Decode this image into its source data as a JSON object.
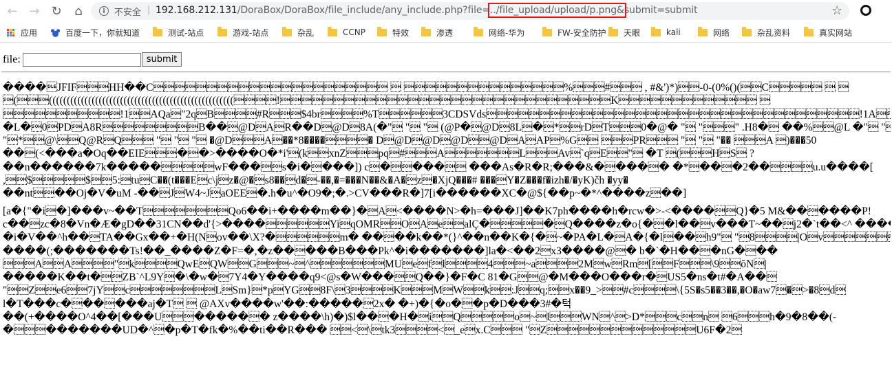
{
  "browser": {
    "security_label": "不安全",
    "url_host": "192.168.212.131",
    "url_path_before": "/DoraBox/DoraBox/file_include/any_include.php?file=",
    "url_highlight": "../file_upload/upload/p.png&",
    "url_path_after": "submit=submit",
    "highlight_color": "#e0161b"
  },
  "bookmarks": [
    {
      "label": "应用",
      "icon": "apps-icon"
    },
    {
      "label": "百度一下，你就知道",
      "icon": "paw-icon"
    },
    {
      "label": "测试-站点",
      "icon": "folder-icon"
    },
    {
      "label": "游戏-站点",
      "icon": "folder-icon"
    },
    {
      "label": "杂乱",
      "icon": "folder-icon"
    },
    {
      "label": "CCNP",
      "icon": "folder-icon"
    },
    {
      "label": "特效",
      "icon": "folder-icon"
    },
    {
      "label": "渗透",
      "icon": "folder-icon"
    },
    {
      "label": "网络-华为",
      "icon": "folder-icon"
    },
    {
      "label": "FW-安全防护",
      "icon": "folder-icon"
    },
    {
      "label": "天眼",
      "icon": "folder-icon"
    },
    {
      "label": "kali",
      "icon": "folder-icon"
    },
    {
      "label": "网络",
      "icon": "folder-icon"
    },
    {
      "label": "杂乱资料",
      "icon": "folder-icon"
    },
    {
      "label": "真实网站",
      "icon": "folder-icon"
    }
  ],
  "form": {
    "label": "file:",
    "input_value": "",
    "submit_label": "submit"
  },
  "output_lines": [
    "����\u0010JFIF\u0001\u0001\u0001HH��C\u0001\u0001\u0001\u0001\u0001\u0001\u0001\u0001\u0001\u0001\u0001\u0001\u0001\u0001\u0001\u0001\u0001\u0001\u0001\u0001\u0001\u0001 \u0001 \u0001\u0001\u0001\u0001\u0001\u0001\u0001\u0001\u0001\u0001\u0001\u0001\u0001\u0001\u0001%\u0001\u0001\u0001#\u0001\u0001\u0001 , #&')*)\u0001\u0001-0-(0%()(\u0001\u0001C\u0001\u0001\u0001\u0001\u0001 \u0001 \u0001",
    "\u0001(\u0001\u0001\u0001((((((((((((((((((((((((((((((((((((((((((((((((((((\u0001\u0001\u0001\u0001!\u0001\u0001\u0001\u0001\u0001\u0001\u0001\u0001\u0001\u0001\u0001\u0001\u0001\u0001\u0001\u0001\u0001\u0001\u0001\u0001\u0001\u0001\u0001\u0001\u0001\u0001\u0001\u0001\u0001\u0001\u0001K\u0001\u0001\u0001\u0001\u0001\u0001\u0001\u0001\u0001\u0001\u0001\u0001\u0001 \u0001",
    "\u0001\u0001\u0001\u0001\u0001\u0001\u0001\u0001\u0001\u0001\u0001!1\u0001\u0001AQa\u0001\"2q\u0001B\u0001\u0001\u0001\u0001#R\u0001\u0001\u0001$4br\u0001\u0001\u0001\u0001%T\u0001\u0001\u0001\u0001\u0001\u00013CDSVds\u0001\u0001\u0001\u0001\u0001\u0001\u0001\u0001\u0001\u0001\u0001\u0001\u0001\u0001\u0001\u0001\u0001\u0001\u0001\u0001\u0001\u0001\u0001\u0001\u0001\u0001\u0001\u0001\u0001\u0001\u0001\u0001\u0001\u0001\u0001!1A\u0001\u0001\u0001\u0001\u0001\u0001\u0001\u0001\u0001?",
    "�L�\u00010\u0001PD\u0001A8R\u0001\u0001\u0001\u0001\u0001\u0001\u0001\u0001\u0001B��\u0001@D\u0001A\u0001R��D\u0001@D\u00018A(�\"\u0001 \"\u0001 \"\u0001 (@P�\u0001@D\u00018L\u0001�\u0001*\u0001\u0001rD\u0001T\u0001\u0001\u00010�@� \"\u0001 \"\u0001\u0001\u0001\" .H8�\u0001 ��%\u0001\u0001@L �\"\u0001 \"\u0001 �\"\u0001",
    "\"\u0001*\u0001\u0001@\\\u0001\u0001Q@R\u0001Q\u0001\u0001\u0001 \"\u0001 \"\u0001 \"\u0001 �@D\u0001\u0001\u0001A\u0001��*8����\u0001\u0001\u0001\u0001� D\u0001@D\u0001@D\u0001@D\u0001\u0001@D\u0001A\u0001AP\u0001%G\u0001\u0001 \u0001\u0001\u0001PR\u0001\u0001\u0001 \"\u0001 \"\u0001 \"�� \u0001\u0001\u0001A \u0001)���50",
    "��\u0001(<���a�Oq��EIE\u0001\u0001\u0001�\u0001�>����O�*i'\u0001(k\u0001\u0001xnZ\u0001\u0001\u0001pq\u0001#\u0001\u0001\u0001A\u0001\u0001\u0001\u0001\u0001\u0001\u0001L\u0001\u0001\u0001Av\u0001`q\u0001E\u0001\u0001\"\u0001 �T \u0001(\u0001\u0001\u0001H\u0001S\u0001 ?",
    "��n������7k�����\u0001\u0001\u0001\u0001\u0001wF���\u0001\u0001s�i�\u0001���]) c\u0001�\u0001\u0001���\u0001\u0001 ���As�R�R;���&�\u0001���\u0001� �*\u0001��\u0001�2��\u0001\u0001\u0001\u0001u.u����[",
    ",\u0001\u0001$\u0001\u0001\u0001\u0001\u0001$\u0001\u00015:\u0001tu\u0001C��(t���E\u0001c\\j\u0001z�@�\u0001s8��\u0001d�\u0001-��,�=���N��&�A�\u0001z\u0001�XjQ���# ���\u0001Y�Z���f�izh�/�yK)čh �yy�",
    "��nt\u0001\u0001��Oj�V�uM -��\u0001J\u0001W4~J\u0001aOEE\u0001�.h�u^�O9�;�.>CV���R�]7[i������XC�@${��p~�*^����z\u0001��]",
    "[a�{\"�i\u0001�]���v~��T\u0001\u0001\u0001\u0001\u0001\u0001\u0001\u0001Qo6��i+����m��}�\u0001A\u0001<����N>�h=���J]��K7ph����h�rcw�>-<����\u0001\u0001Q}�5 M&��\u0001����P!",
    "c��\u0001zc�8�Vn�Æ�gD��31CN��d'{>����\u0001\u0001\u0001\u0001\u0001\u0001Yi\u0001qOMR\u0001\u0001O\u0001A\u0001e\u0001\u0001alÇ�\u0001\u0001\u0001\u0001\u0001�\u0001Q����z�o{�\u0001�l��\u0001v���T~��\u0001j2�`t��<^ ����(-)\u0001",
    "�i�V��^h��\u0001TA��Gx��+�H(N\u0001ov��\\X?�\u0001\u0001\u0001\u0001\u0001\u0001m� ��\u0001��k��*(}^��n��K�{�\u0001~�PA�L�\u0001A�{�l\u0001��\u0001h9\"\u0001 \"\u00018\u0001\u0001\u0001\u0001|O\u0001v\u0001\u0001\u0001\u0001\u0001\u0001\u0001\u0001S\u0001\u0001?",
    "����(;�������Ts!��_����Z�F=�,�z��\u0001���B���Pk^�i�������]la�<��2\u0001x3����@\u0001� b�`�H��\u0001�nG�\u0001��",
    "\u0001\u0001\u0001A\u0001\u0001A\u0001\u0001\u0001\u0001\"\u0001k\u0001\u0001\u0001\u0001QwE\u0001QW\u0001\u0001G\u0001\u0001\u0001~\u0001^\u0001\u0001\u0001\u0001\u0001\u0001\u0001MU\u0001e\u0001f\u0001l\u0001\u0001\u0001\u00014\u0001\u0001\u0001~a\u0001\u0001\u0001\u00012M\u0001w\u0001Rm\u0001[\u0001\u0001F\u0001\u0001\u0001\\9\u0001\u0001ŏN\u0001|",
    "�����K��t�\u0001\u0001ZB`^L9Y\u0001�\\�w�\u00017Y4�Y����q9<@s�W���\u0001\u0001Q��}�F�C 81�G\u0001\u0001@�M���O���r�\u0001US5�ns�t#�A��\u0001",
    "\"\u0001\u0001Z\u0001\u0001e6\u0001\u00017jY\u0001\u0001c\u0001\u0001\u0001\u0001\u0001\u0001\u0001\u0001L\u0001Sm}\u0001*p\u0001YG\u0001\u00018F\\\u00013\u0001\u0001\u0001\u0001K\u0001\u0001\u0001M\u0001W\u0001\u0001k\u0001\u0001:J\u0001\u0001q;\u0001\u0001x��9_>\u0001\u0001#c\u0001\u0001\u0001\u0001\\{5S�s5��3��,�O�aw7\u0001�\u0001>�8\u0001d\u0001",
    "l�T���c�\u0001��\u0001���aj�T\u0001 \u0001 @AXv����w'��:�����\u00012x� �+)�{�o�\u0001�p�D���3#�턱",
    "��(+����O^4��[���U\u0001\u0001\u0001�����\u0001� z����\\h)�)$l��\u0001�H�\u0001i\u0001\u0001Q\u0001\u0001\u0001\u0001\u0001o\u0001~\u0001l\u0001\u0001\u0001WN\u0001^\u0001>D*\u0001\u0001\u0001c\u0001\u0001n\u0001 \u00016\u0001\u0001\u0001h�9�8��(-",
    "�\u0001\u0001\u0001�������UD�^\u0001�p�T�fk�%��ti��R��� \u0001\u0001<\u0001\\\u0001tk3\u0001\u0001\u0001\u0001<\u0001_e\u0001x.C\u0001\u0001\u0001 \"\u0001Z\u0001\u0001\u0001\u0001\u0001\u0001\u0001\u0001\u0001\u0001\u0001\u0001\u0001\u0001U6F�2\u0001"
  ]
}
